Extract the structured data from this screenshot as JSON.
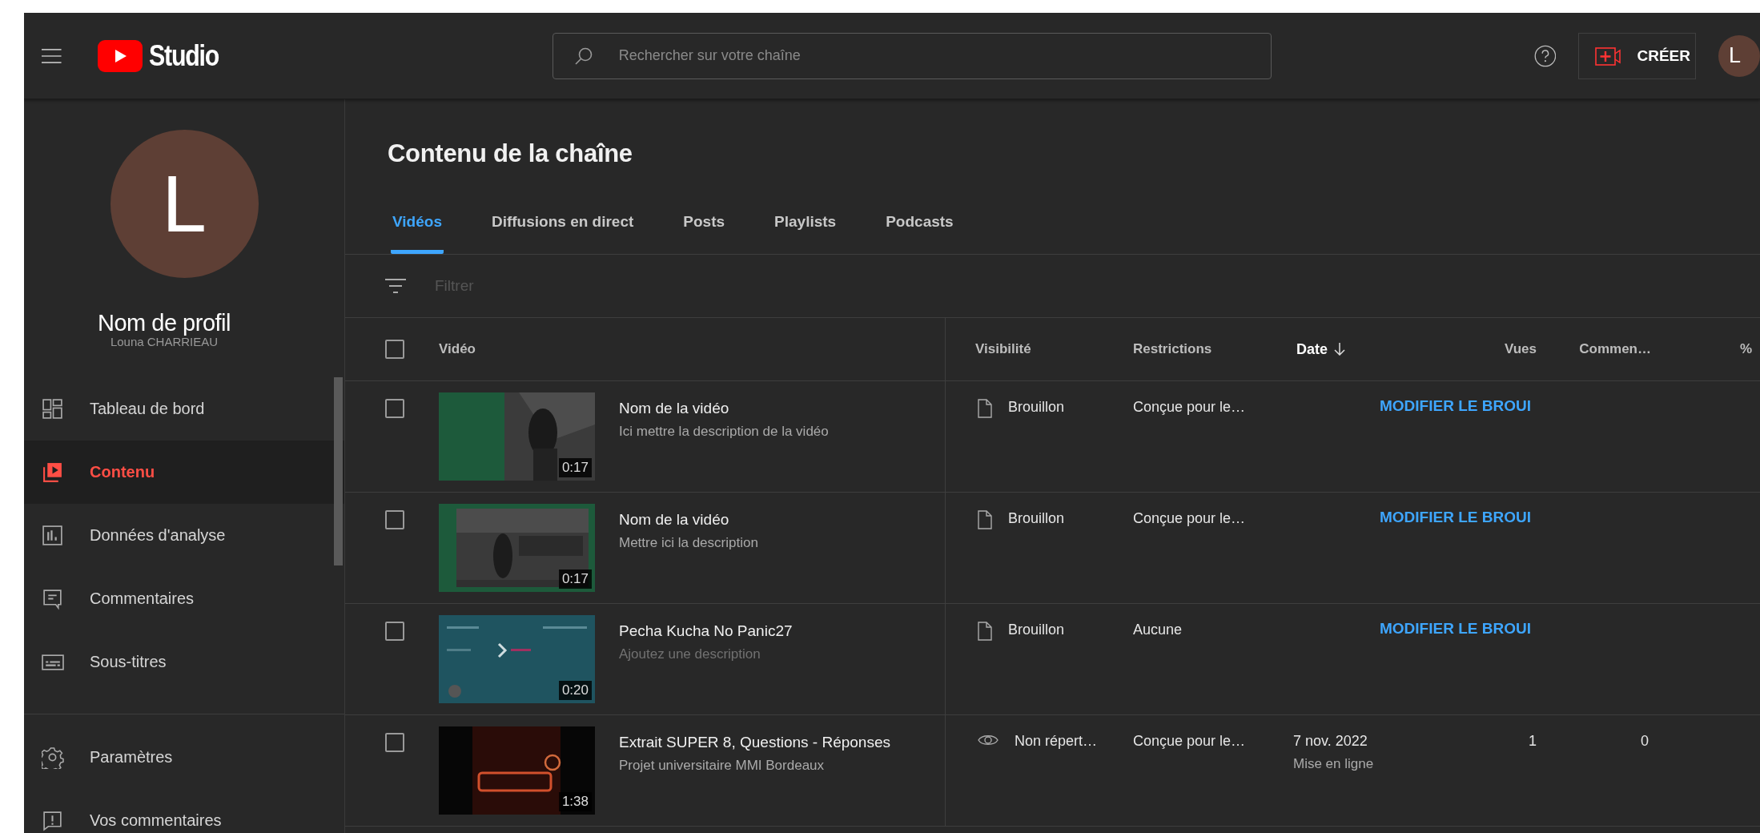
{
  "header": {
    "logo_text": "Studio",
    "search": {
      "placeholder": "Rechercher sur votre chaîne"
    },
    "create_button": "CRÉER",
    "avatar_letter": "L"
  },
  "sidebar": {
    "avatar_letter": "L",
    "overlay_label": "Nom de profil",
    "owner_name": "Louna CHARRIEAU",
    "items": [
      {
        "label": "Tableau de bord",
        "selected": false
      },
      {
        "label": "Contenu",
        "selected": true
      },
      {
        "label": "Données d'analyse",
        "selected": false
      },
      {
        "label": "Commentaires",
        "selected": false
      },
      {
        "label": "Sous-titres",
        "selected": false
      }
    ],
    "footer_items": [
      {
        "label": "Paramètres",
        "selected": false
      },
      {
        "label": "Vos commentaires",
        "selected": false
      }
    ]
  },
  "page": {
    "title": "Contenu de la chaîne",
    "tabs": [
      {
        "label": "Vidéos",
        "selected": true
      },
      {
        "label": "Diffusions en direct",
        "selected": false
      },
      {
        "label": "Posts",
        "selected": false
      },
      {
        "label": "Playlists",
        "selected": false
      },
      {
        "label": "Podcasts",
        "selected": false
      }
    ],
    "filter": {
      "placeholder": "Filtrer"
    },
    "table": {
      "select_all_checked": false,
      "columns": [
        {
          "label": "Vidéo",
          "sorted": false
        },
        {
          "label": "Visibilité",
          "sorted": false
        },
        {
          "label": "Restrictions",
          "sorted": false
        },
        {
          "label": "Date",
          "sorted": true
        },
        {
          "label": "Vues",
          "sorted": false
        },
        {
          "label": "Commen…",
          "sorted": false
        },
        {
          "label": "%",
          "sorted": false
        }
      ],
      "rows": [
        {
          "checked": false,
          "duration": "0:17",
          "title": "Nom de la vidéo",
          "description": "Ici mettre la description de la vidéo",
          "description_hint": false,
          "visibility": {
            "kind": "draft",
            "label": "Brouillon"
          },
          "restrictions": "Conçue pour le…",
          "action": "MODIFIER LE BROUI"
        },
        {
          "checked": false,
          "duration": "0:17",
          "title": "Nom de la vidéo",
          "description": "Mettre ici la description",
          "description_hint": false,
          "visibility": {
            "kind": "draft",
            "label": "Brouillon"
          },
          "restrictions": "Conçue pour le…",
          "action": "MODIFIER LE BROUI"
        },
        {
          "checked": false,
          "duration": "0:20",
          "title": "Pecha Kucha No Panic27",
          "description": "Ajoutez une description",
          "description_hint": true,
          "visibility": {
            "kind": "draft",
            "label": "Brouillon"
          },
          "restrictions": "Aucune",
          "action": "MODIFIER LE BROUI"
        },
        {
          "checked": false,
          "duration": "1:38",
          "title": "Extrait SUPER 8, Questions - Réponses",
          "description": "Projet universitaire MMI Bordeaux",
          "description_hint": false,
          "visibility": {
            "kind": "unlisted",
            "label": "Non répert…"
          },
          "restrictions": "Conçue pour le…",
          "date": "7 nov. 2022",
          "date_note": "Mise en ligne",
          "views": "1",
          "comments": "0"
        }
      ]
    }
  }
}
